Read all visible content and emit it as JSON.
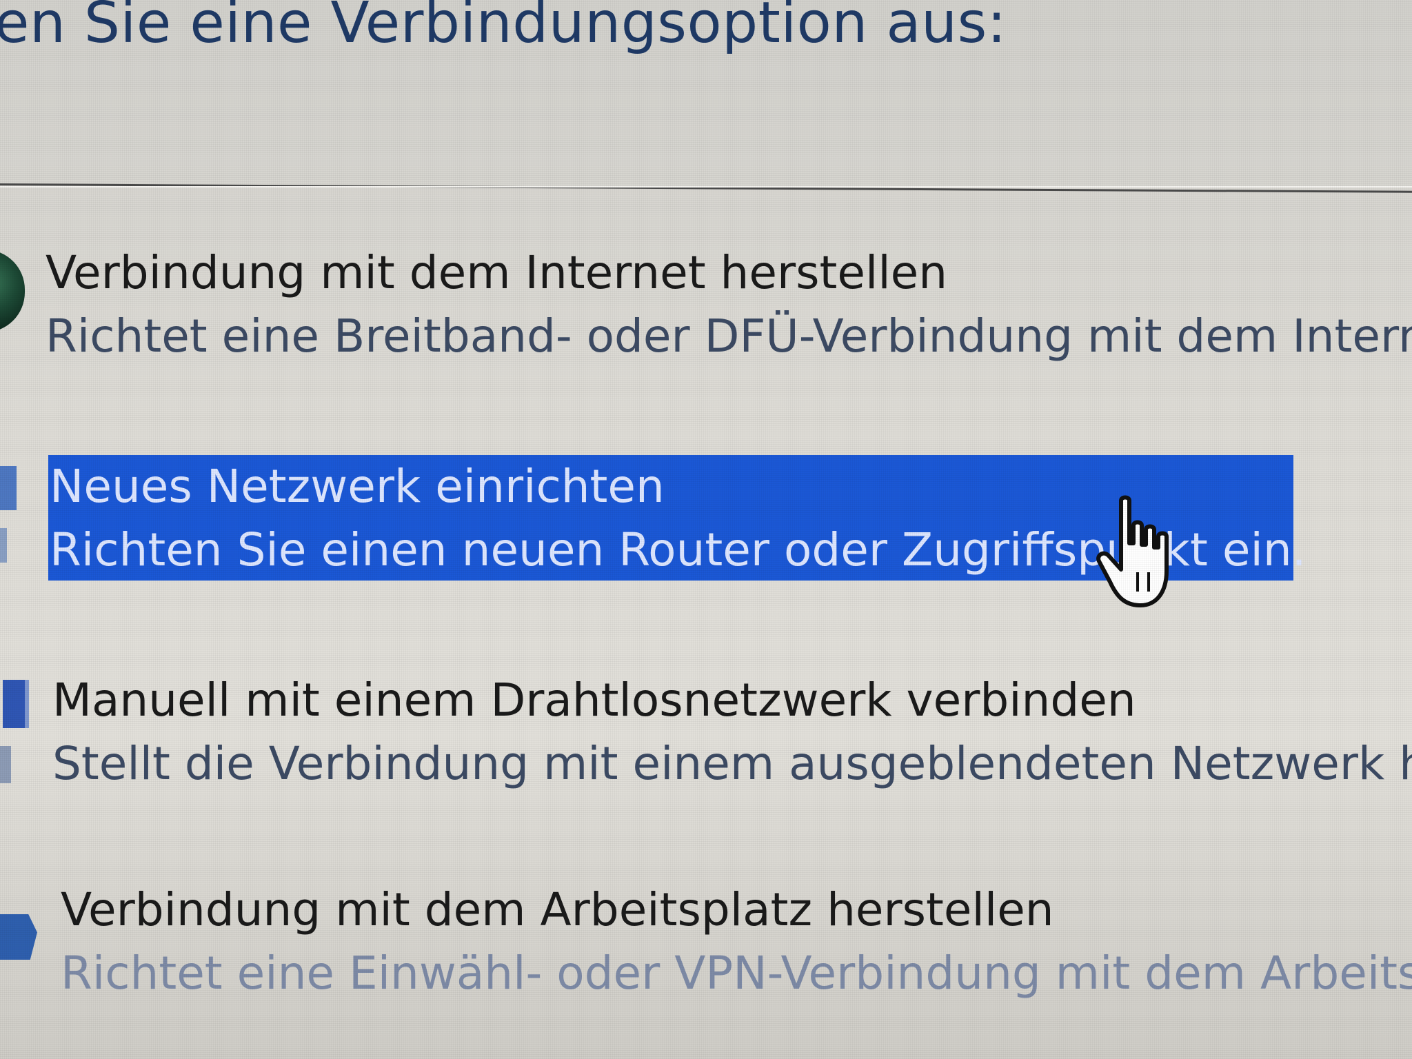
{
  "dialog": {
    "heading": "en Sie eine Verbindungsoption aus:"
  },
  "options": [
    {
      "title": "Verbindung mit dem Internet herstellen",
      "description": "Richtet eine Breitband- oder DFÜ-Verbindung mit dem Intern",
      "icon": "globe-icon",
      "selected": false
    },
    {
      "title": "Neues Netzwerk einrichten",
      "description": "Richten Sie einen neuen Router oder Zugriffspunkt ein.",
      "icon": "network-icon",
      "selected": true
    },
    {
      "title": "Manuell mit einem Drahtlosnetzwerk verbinden",
      "description": "Stellt die Verbindung mit einem ausgeblendeten Netzwerk he",
      "icon": "wireless-network-icon",
      "selected": false
    },
    {
      "title": "Verbindung mit dem Arbeitsplatz herstellen",
      "description": "Richtet eine Einwähl- oder VPN-Verbindung mit dem Arbeitsp",
      "icon": "workplace-icon",
      "selected": false
    }
  ],
  "colors": {
    "selection": "#1b58d6",
    "heading": "#1f3a66",
    "background": "#dedcd6"
  },
  "cursor": "hand-pointer-icon"
}
